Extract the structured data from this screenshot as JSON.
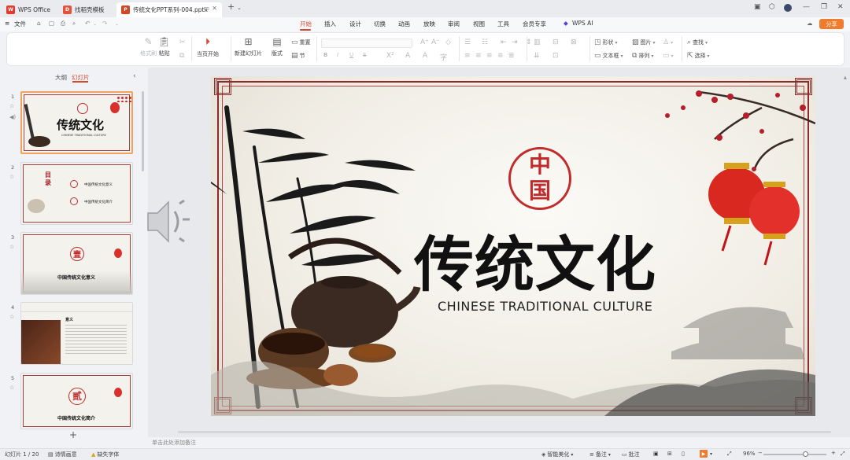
{
  "tabs": [
    {
      "label": "WPS Office",
      "logo": "W",
      "color": "#e23a2f"
    },
    {
      "label": "找稻壳模板",
      "logo": "D",
      "color": "#e3533a"
    },
    {
      "label": "传统文化PPT系列-004.pptx",
      "logo": "P",
      "color": "#d24526"
    }
  ],
  "menu": {
    "file": "文件",
    "items": [
      "开始",
      "插入",
      "设计",
      "切换",
      "动画",
      "放映",
      "审阅",
      "视图",
      "工具",
      "会员专享"
    ],
    "wps_ai": "WPS AI",
    "share": "分享"
  },
  "ribbon": {
    "format_painter": "格式刷",
    "paste": "粘贴",
    "from_current": "当页开始",
    "new_slide": "新建幻灯片",
    "layout": "版式",
    "reset": "重置",
    "section": "节",
    "shape": "形状",
    "picture": "图片",
    "find": "查找",
    "textbox": "文本框",
    "arrange": "排列",
    "select": "选择",
    "bold": "B",
    "italic": "I",
    "underline": "U",
    "strike": "S"
  },
  "left_panel": {
    "tab_outline": "大纲",
    "tab_slides": "幻灯片",
    "thumbs": [
      {
        "num": "1",
        "title": "传统文化",
        "sub": "CHINESE TRADITIONAL CULTURE"
      },
      {
        "num": "2",
        "title": "目录",
        "item1": "中国传统文化意义",
        "item2": "中国传统文化简介"
      },
      {
        "num": "3",
        "seal": "壹",
        "title": "中国传统文化意义"
      },
      {
        "num": "4",
        "title": "意义"
      },
      {
        "num": "5",
        "seal": "贰",
        "title": "中国传统文化简介"
      }
    ]
  },
  "slide": {
    "seal": "中国",
    "title": "传统文化",
    "subtitle": "CHINESE  TRADITIONAL  CULTURE"
  },
  "notes_placeholder": "单击此处添加备注",
  "status": {
    "slide_counter": "幻灯片 1 / 20",
    "proofread": "诗情画意",
    "missing_font": "缺失字体",
    "smart_beautify": "智能美化",
    "notes": "备注",
    "comments": "批注",
    "zoom": "96%"
  },
  "colors": {
    "accent": "#d24a2f",
    "frame_red": "#8f2a2a",
    "seal_red": "#c22b2b",
    "share_orange": "#f07c2e"
  }
}
